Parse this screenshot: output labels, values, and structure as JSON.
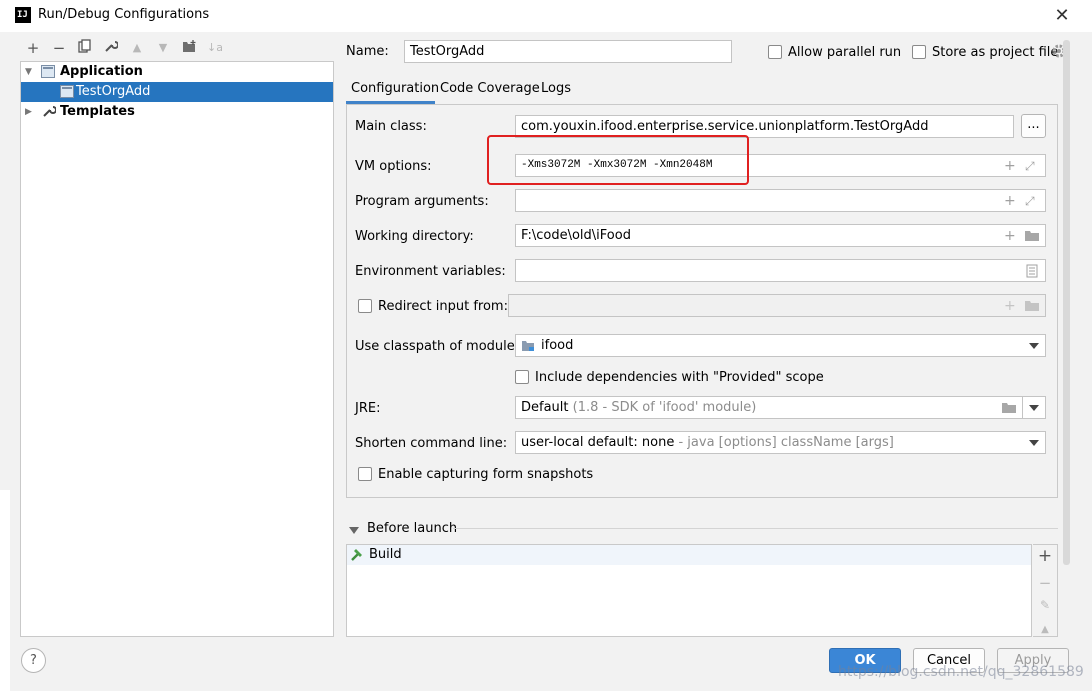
{
  "window": {
    "app_icon": "IJ",
    "title": "Run/Debug Configurations",
    "close_glyph": "✕"
  },
  "toolbar": {
    "add_glyph": "+",
    "remove_glyph": "−",
    "copy_glyph": "⧉",
    "wrench_glyph": "🔧",
    "up_glyph": "▲",
    "down_glyph": "▼",
    "folder_glyph": "▪",
    "sort_glyph": "↓a"
  },
  "tree": {
    "items": [
      {
        "label": "Application",
        "icon": "application-config-icon"
      },
      {
        "label": "TestOrgAdd",
        "icon": "application-config-icon"
      },
      {
        "label": "Templates",
        "icon": "wrench-icon"
      }
    ]
  },
  "header": {
    "name_label": "Name:",
    "name_value": "TestOrgAdd",
    "allow_parallel_label": "Allow parallel run",
    "store_project_label": "Store as project file"
  },
  "tabs": [
    {
      "label": "Configuration",
      "active": true
    },
    {
      "label": "Code Coverage",
      "active": false
    },
    {
      "label": "Logs",
      "active": false
    }
  ],
  "form": {
    "main_class_label": "Main class:",
    "main_class_value": "com.youxin.ifood.enterprise.service.unionplatform.TestOrgAdd",
    "browse_button": "...",
    "vm_options_label": "VM options:",
    "vm_options_value": "-Xms3072M -Xmx3072M -Xmn2048M",
    "program_args_label": "Program arguments:",
    "program_args_value": "",
    "working_dir_label": "Working directory:",
    "working_dir_value": "F:\\code\\old\\iFood",
    "env_vars_label": "Environment variables:",
    "env_vars_value": "",
    "redirect_input_label": "Redirect input from:",
    "classpath_label": "Use classpath of module:",
    "classpath_value": "ifood",
    "include_deps_label": "Include dependencies with \"Provided\" scope",
    "jre_label": "JRE:",
    "jre_value": "Default",
    "jre_detail": "(1.8 - SDK of 'ifood' module)",
    "shorten_label": "Shorten command line:",
    "shorten_value": "user-local default: none",
    "shorten_detail": "- java [options] className [args]",
    "form_snapshots_label": "Enable capturing form snapshots"
  },
  "before_launch": {
    "title": "Before launch",
    "items": [
      {
        "label": "Build",
        "icon": "hammer-icon"
      }
    ]
  },
  "footer": {
    "help": "?",
    "ok": "OK",
    "cancel": "Cancel",
    "apply": "Apply"
  },
  "watermark": "https://blog.csdn.net/qq_32861589",
  "colors": {
    "accent": "#2675bf",
    "highlight_box": "#e02020"
  }
}
